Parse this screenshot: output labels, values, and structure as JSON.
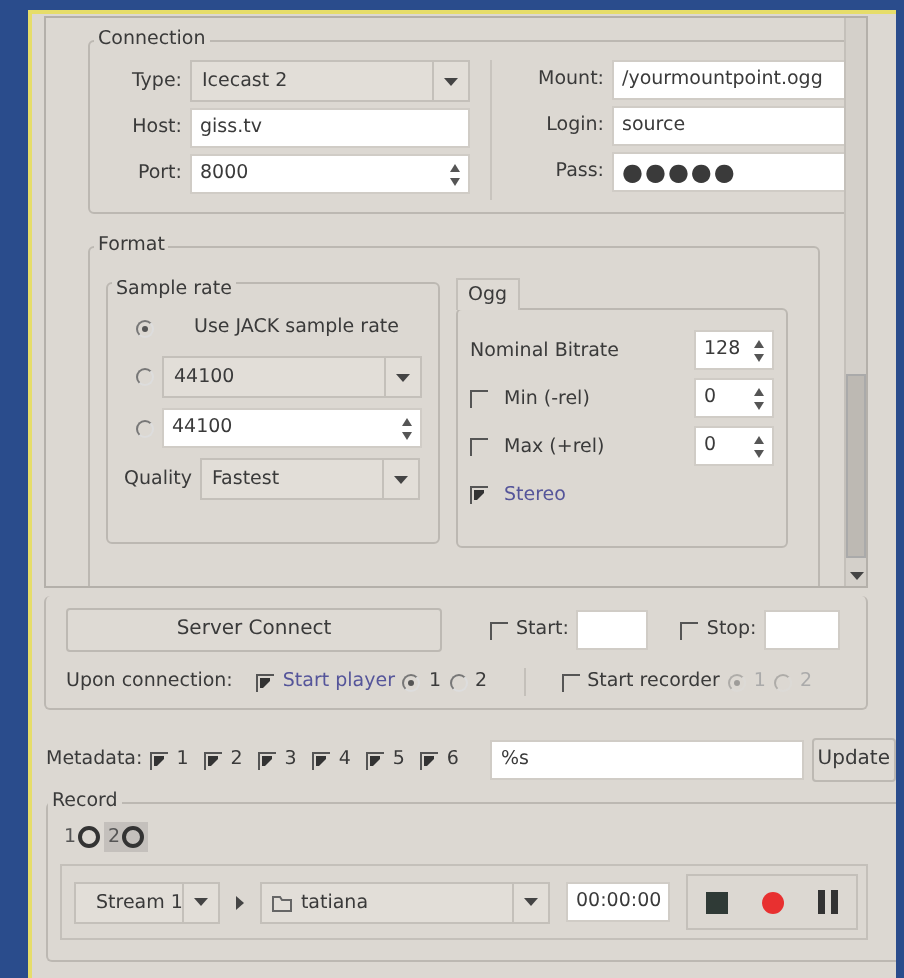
{
  "connection": {
    "title": "Connection",
    "left": [
      {
        "kind": "combo",
        "label": "Type:",
        "value": "Icecast 2"
      },
      {
        "kind": "text",
        "label": "Host:",
        "value": "giss.tv"
      },
      {
        "kind": "spin",
        "label": "Port:",
        "value": "8000"
      }
    ],
    "right": [
      {
        "kind": "text",
        "label": "Mount:",
        "value": "/yourmountpoint.ogg"
      },
      {
        "kind": "text",
        "label": "Login:",
        "value": "source"
      },
      {
        "kind": "password",
        "label": "Pass:",
        "value": "●●●●●"
      }
    ]
  },
  "format": {
    "title": "Format",
    "sample_rate": {
      "title": "Sample rate",
      "options": [
        {
          "kind": "label",
          "value": "Use JACK sample rate",
          "selected": true
        },
        {
          "kind": "combo",
          "value": "44100",
          "selected": false
        },
        {
          "kind": "spin",
          "value": "44100",
          "selected": false
        }
      ],
      "quality": {
        "label": "Quality",
        "value": "Fastest"
      }
    },
    "codec": {
      "tab": "Ogg",
      "rows": [
        {
          "kind": "spin",
          "label": "Nominal Bitrate",
          "value": "128"
        },
        {
          "kind": "check_spin",
          "label": "Min (-rel)",
          "checked": false,
          "value": "0"
        },
        {
          "kind": "check_spin",
          "label": "Max (+rel)",
          "checked": false,
          "value": "0"
        },
        {
          "kind": "check",
          "label": "Stereo",
          "checked": true
        }
      ]
    }
  },
  "server": {
    "connect": "Server Connect",
    "start": {
      "label": "Start:",
      "checked": false
    },
    "stop": {
      "label": "Stop:",
      "checked": false
    },
    "upon": {
      "label": "Upon connection:",
      "player": {
        "label": "Start player",
        "checked": true,
        "options": [
          {
            "label": "1",
            "selected": true,
            "disabled": false
          },
          {
            "label": "2",
            "selected": false,
            "disabled": false
          }
        ]
      },
      "recorder": {
        "label": "Start recorder",
        "checked": false,
        "options": [
          {
            "label": "1",
            "selected": true,
            "disabled": true
          },
          {
            "label": "2",
            "selected": false,
            "disabled": true
          }
        ]
      }
    }
  },
  "metadata": {
    "label": "Metadata:",
    "checks": [
      {
        "label": "1",
        "checked": true
      },
      {
        "label": "2",
        "checked": true
      },
      {
        "label": "3",
        "checked": true
      },
      {
        "label": "4",
        "checked": true
      },
      {
        "label": "5",
        "checked": true
      },
      {
        "label": "6",
        "checked": true
      }
    ],
    "value": "%s",
    "button": "Update"
  },
  "record": {
    "title": "Record",
    "tabs": [
      {
        "label": "1",
        "selected": false
      },
      {
        "label": "2",
        "selected": true
      }
    ],
    "stream": "Stream 1",
    "folder": "tatiana",
    "time": "00:00:00",
    "buttons": [
      {
        "kind": "stop"
      },
      {
        "kind": "record"
      },
      {
        "kind": "pause"
      }
    ]
  }
}
